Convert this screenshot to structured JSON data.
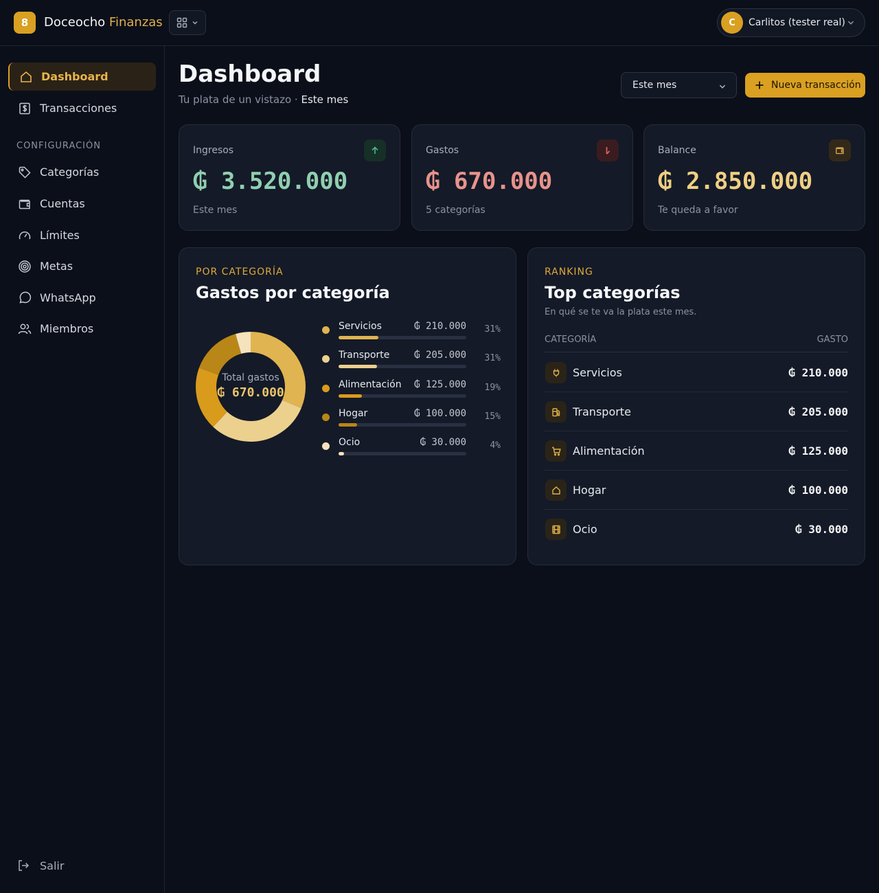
{
  "app": {
    "logo_badge": "8",
    "brand_main": "Doceocho",
    "brand_accent": "Finanzas",
    "user_initial": "C",
    "user_name": "Carlitos (tester real)"
  },
  "sidebar": {
    "items": [
      {
        "label": "Dashboard",
        "icon": "home-icon",
        "active": true
      },
      {
        "label": "Transacciones",
        "icon": "dollar-receipt-icon"
      }
    ],
    "section_label": "CONFIGURACIÓN",
    "config_items": [
      {
        "label": "Categorías",
        "icon": "tag-icon"
      },
      {
        "label": "Cuentas",
        "icon": "wallet-icon"
      },
      {
        "label": "Límites",
        "icon": "gauge-icon"
      },
      {
        "label": "Metas",
        "icon": "target-icon"
      },
      {
        "label": "WhatsApp",
        "icon": "chat-bubble-icon"
      },
      {
        "label": "Miembros",
        "icon": "users-icon"
      }
    ],
    "logout_label": "Salir"
  },
  "header": {
    "title": "Dashboard",
    "subtitle": "Tu plata de un vistazo ·",
    "subtitle_period": "Este mes",
    "period_select": "Este mes",
    "new_button": "Nueva transacción"
  },
  "stats": [
    {
      "label": "Ingresos",
      "value": "₲ 3.520.000",
      "foot": "Este mes",
      "icon": "arrow-up-icon",
      "color": "#8fcfb0"
    },
    {
      "label": "Gastos",
      "value": "₲ 670.000",
      "foot": "5 categorías",
      "icon": "arrow-down-icon",
      "color": "#e8928b"
    },
    {
      "label": "Balance",
      "value": "₲ 2.850.000",
      "foot": "Te queda a favor",
      "icon": "wallet-icon",
      "color": "#f0cf84"
    }
  ],
  "category_panel": {
    "eyebrow": "POR CATEGORÍA",
    "title": "Gastos por categoría",
    "total_label": "Total gastos",
    "total_value": "₲ 670.000"
  },
  "chart_data": {
    "type": "pie",
    "categories": [
      "Servicios",
      "Transporte",
      "Alimentación",
      "Hogar",
      "Ocio"
    ],
    "values": [
      210000,
      205000,
      125000,
      100000,
      30000
    ],
    "amount_labels": [
      "₲ 210.000",
      "₲ 205.000",
      "₲ 125.000",
      "₲ 100.000",
      "₲ 30.000"
    ],
    "percent_labels": [
      "31%",
      "31%",
      "19%",
      "15%",
      "4%"
    ],
    "colors": [
      "#e0b450",
      "#ecd08e",
      "#d99b1c",
      "#b98618",
      "#f5e3bd"
    ]
  },
  "ranking_panel": {
    "eyebrow": "RANKING",
    "title": "Top categorías",
    "subtitle": "En qué se te va la plata este mes.",
    "col_category": "CATEGORÍA",
    "col_amount": "GASTO",
    "rows": [
      {
        "name": "Servicios",
        "amount": "₲ 210.000",
        "icon": "plug-icon"
      },
      {
        "name": "Transporte",
        "amount": "₲ 205.000",
        "icon": "fuel-icon"
      },
      {
        "name": "Alimentación",
        "amount": "₲ 125.000",
        "icon": "cart-icon"
      },
      {
        "name": "Hogar",
        "amount": "₲ 100.000",
        "icon": "house-icon"
      },
      {
        "name": "Ocio",
        "amount": "₲ 30.000",
        "icon": "film-icon"
      }
    ]
  }
}
